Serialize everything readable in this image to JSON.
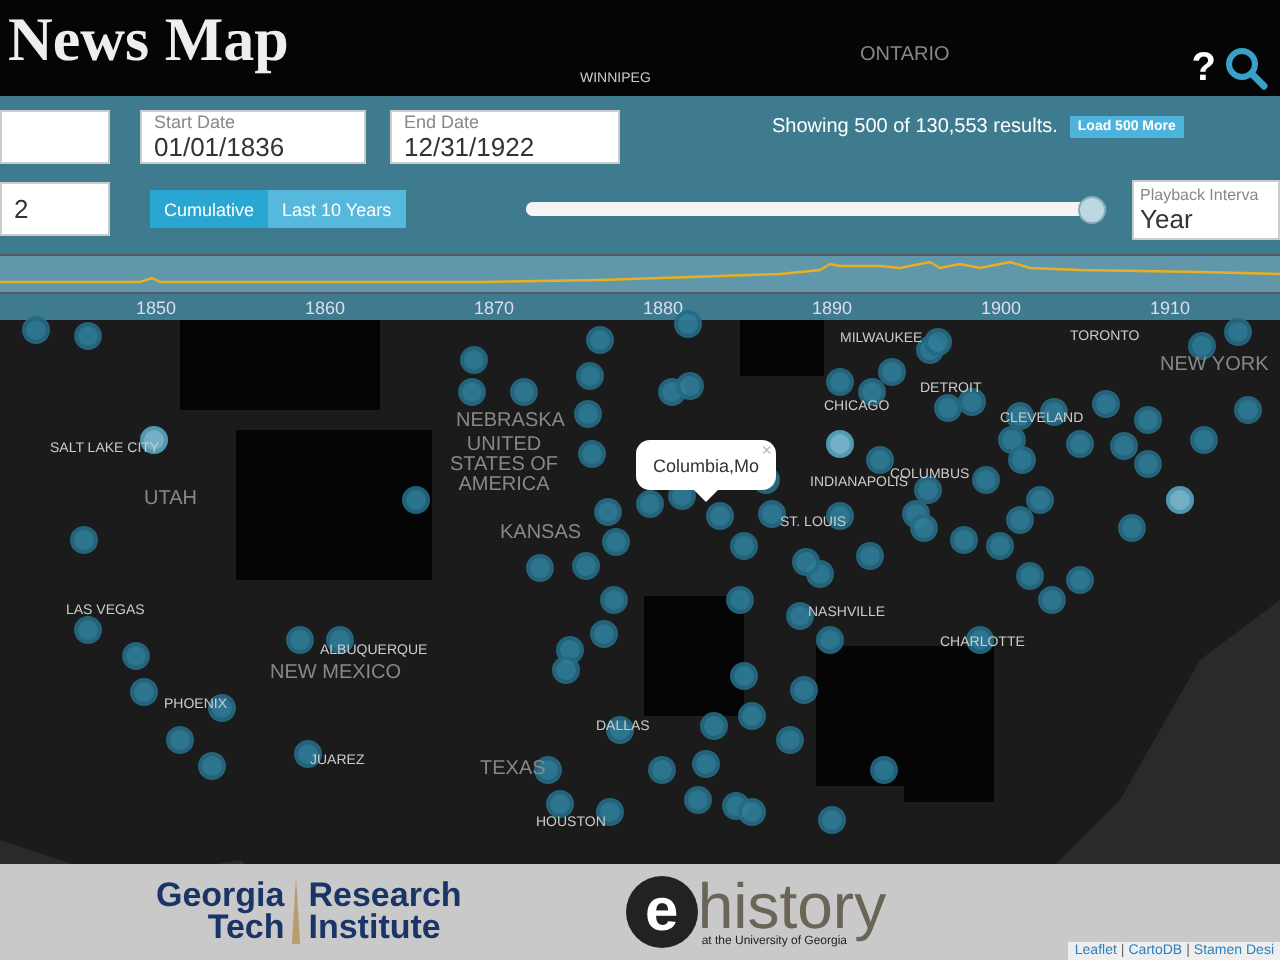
{
  "header": {
    "title": "News Map",
    "help": "?"
  },
  "filters": {
    "start_date": {
      "label": "Start Date",
      "value": "01/01/1836"
    },
    "end_date": {
      "label": "End Date",
      "value": "12/31/1922"
    },
    "results_text": "Showing 500 of 130,553 results.",
    "load_button": "Load 500 More",
    "current": {
      "value": "2"
    },
    "modes": [
      {
        "label": "Cumulative",
        "selected": true
      },
      {
        "label": "Last 10 Years",
        "selected": false
      }
    ],
    "playback": {
      "level": 1
    },
    "interval": {
      "label": "Playback Interva",
      "value": "Year"
    }
  },
  "timeline": {
    "ticks": [
      "1850",
      "1860",
      "1870",
      "1880",
      "1890",
      "1900",
      "1910"
    ]
  },
  "map": {
    "labels": [
      "WINNIPEG",
      "ONTARIO",
      "SALT LAKE CITY",
      "UTAH",
      "LAS VEGAS",
      "PHOENIX",
      "ALBUQUERQUE",
      "NEW MEXICO",
      "JUAREZ",
      "TEXAS",
      "DALLAS",
      "HOUSTON",
      "NEBRASKA",
      "UNITED STATES OF AMERICA",
      "KANSAS",
      "MILWAUKEE",
      "DETROIT",
      "CHICAGO",
      "CLEVELAND",
      "COLUMBUS",
      "INDIANAPOLIS",
      "ST. LOUIS",
      "TORONTO",
      "NEW YORK",
      "NASHVILLE",
      "CHARLOTTE"
    ],
    "popup": {
      "text": "Columbia,Mo",
      "close": "×"
    }
  },
  "footer": {
    "gtri_top": "Georgia",
    "gtri_bottom": "Tech",
    "gtri_right_top": "Research",
    "gtri_right_bottom": "Institute",
    "ehistory_mark": "e",
    "ehistory_word": "history",
    "ehistory_sub": "at the University of Georgia",
    "attribution": [
      "Leaflet",
      "CartoDB",
      "Stamen Desi"
    ],
    "attribution_separator": "|"
  }
}
